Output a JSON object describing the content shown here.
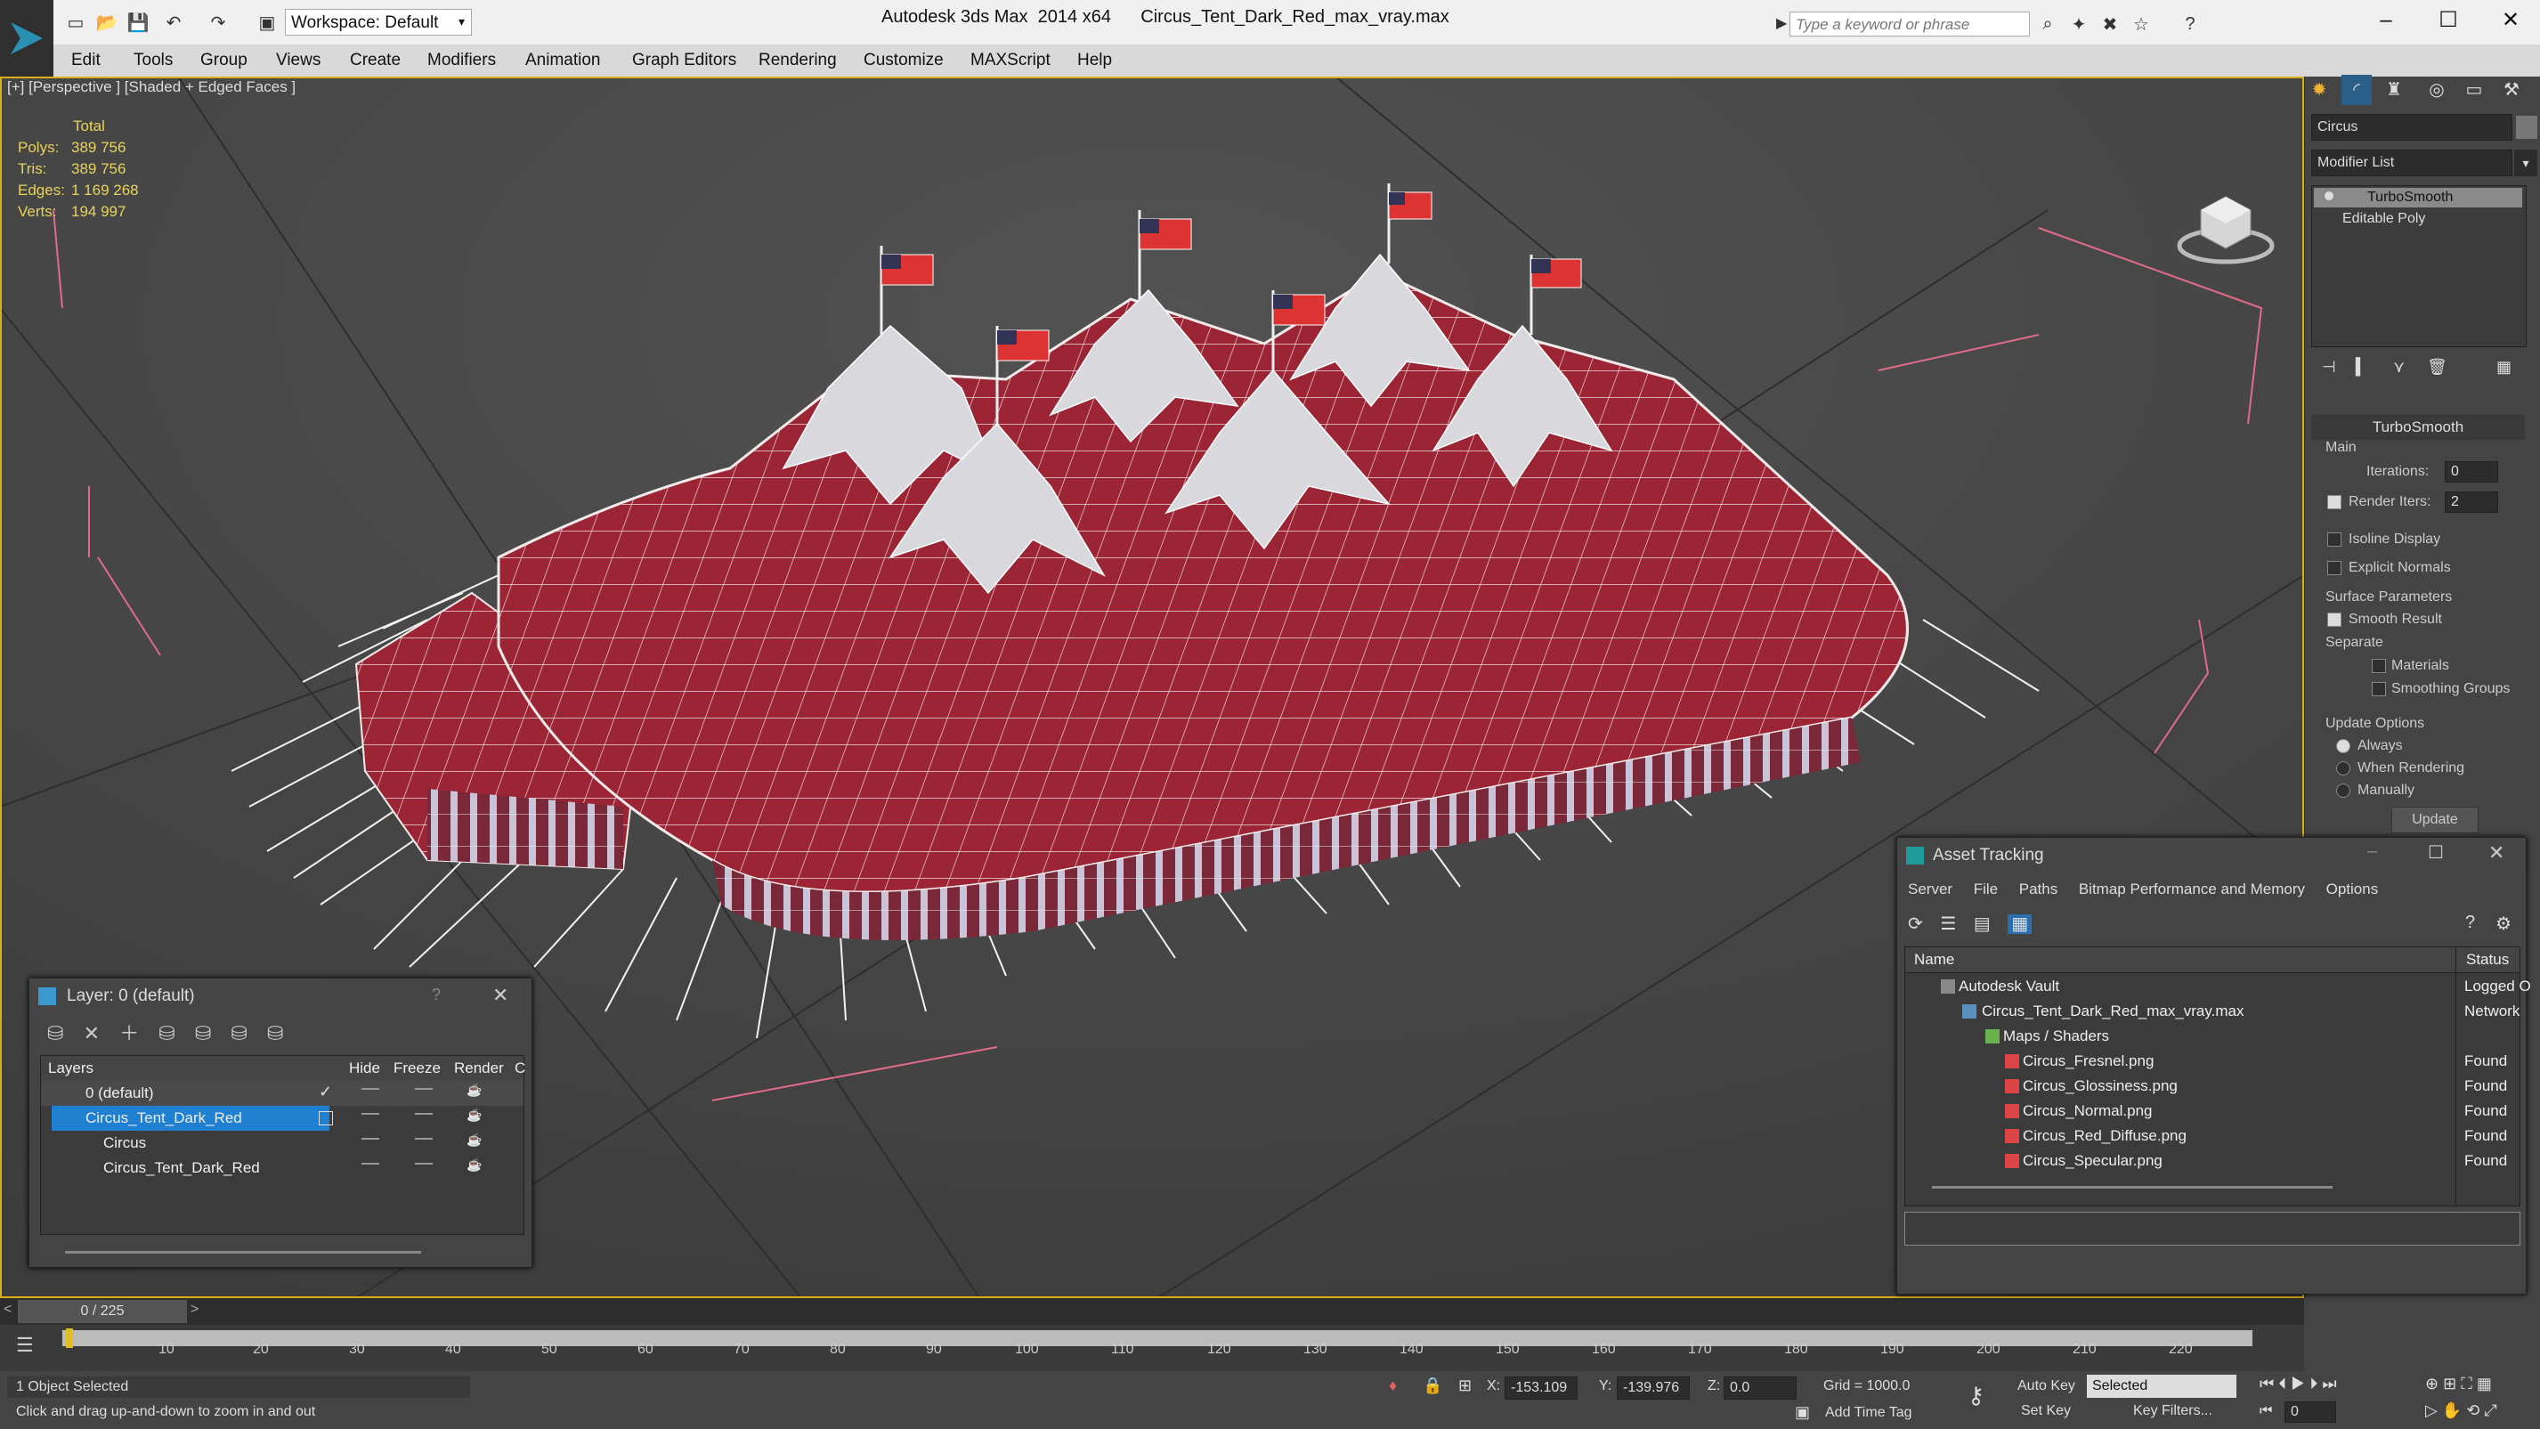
{
  "titlebar": {
    "workspace": "Workspace: Default",
    "app": "Autodesk 3ds Max  2014 x64",
    "file": "Circus_Tent_Dark_Red_max_vray.max",
    "search_placeholder": "Type a keyword or phrase"
  },
  "menu": [
    "Edit",
    "Tools",
    "Group",
    "Views",
    "Create",
    "Modifiers",
    "Animation",
    "Graph Editors",
    "Rendering",
    "Customize",
    "MAXScript",
    "Help"
  ],
  "viewport": {
    "label": "[+] [Perspective ] [Shaded + Edged Faces ]",
    "stats": {
      "header": "Total",
      "rows": [
        {
          "k": "Polys:",
          "v": "389 756"
        },
        {
          "k": "Tris:",
          "v": "389 756"
        },
        {
          "k": "Edges:",
          "v": "1 169 268"
        },
        {
          "k": "Verts:",
          "v": "194 997"
        }
      ]
    }
  },
  "cmdpanel": {
    "object_name": "Circus",
    "modifier_list": "Modifier List",
    "stack": [
      "TurboSmooth",
      "Editable Poly"
    ],
    "rollout_title": "TurboSmooth",
    "main_label": "Main",
    "iterations_label": "Iterations:",
    "iterations_value": "0",
    "render_iters_label": "Render Iters:",
    "render_iters_value": "2",
    "isoline": "Isoline Display",
    "explicit": "Explicit Normals",
    "surface_params": "Surface Parameters",
    "smooth_result": "Smooth Result",
    "separate": "Separate",
    "materials": "Materials",
    "smoothing_groups": "Smoothing Groups",
    "update_options": "Update Options",
    "always": "Always",
    "when_rendering": "When Rendering",
    "manually": "Manually",
    "update_btn": "Update"
  },
  "layer_dialog": {
    "title": "Layer: 0 (default)",
    "help": "?",
    "columns": [
      "Layers",
      "Hide",
      "Freeze",
      "Render",
      "C"
    ],
    "rows": [
      "0 (default)",
      "Circus_Tent_Dark_Red",
      "Circus",
      "Circus_Tent_Dark_Red"
    ]
  },
  "asset_dialog": {
    "title": "Asset Tracking",
    "menu": [
      "Server",
      "File",
      "Paths",
      "Bitmap Performance and Memory",
      "Options"
    ],
    "columns": [
      "Name",
      "Status"
    ],
    "rows": [
      {
        "name": "Autodesk Vault",
        "status": "Logged O"
      },
      {
        "name": "Circus_Tent_Dark_Red_max_vray.max",
        "status": "Network"
      },
      {
        "name": "Maps / Shaders",
        "status": ""
      },
      {
        "name": "Circus_Fresnel.png",
        "status": "Found"
      },
      {
        "name": "Circus_Glossiness.png",
        "status": "Found"
      },
      {
        "name": "Circus_Normal.png",
        "status": "Found"
      },
      {
        "name": "Circus_Red_Diffuse.png",
        "status": "Found"
      },
      {
        "name": "Circus_Specular.png",
        "status": "Found"
      }
    ]
  },
  "timeline": {
    "frame": "0 / 225",
    "ticks": [
      "10",
      "20",
      "30",
      "40",
      "50",
      "60",
      "70",
      "80",
      "90",
      "100",
      "110",
      "120",
      "130",
      "140",
      "150",
      "160",
      "170",
      "180",
      "190",
      "200",
      "210",
      "220"
    ]
  },
  "status": {
    "selected": "1 Object Selected",
    "hint": "Click and drag up-and-down to zoom in and out",
    "x_label": "X:",
    "x": "-153.109",
    "y_label": "Y:",
    "y": "-139.976",
    "z_label": "Z:",
    "z": "0.0",
    "grid": "Grid = 1000.0",
    "auto_key": "Auto Key",
    "selected_dropdown": "Selected",
    "set_key": "Set Key",
    "key_filters": "Key Filters...",
    "add_time_tag": "Add Time Tag",
    "frame_value": "0"
  }
}
